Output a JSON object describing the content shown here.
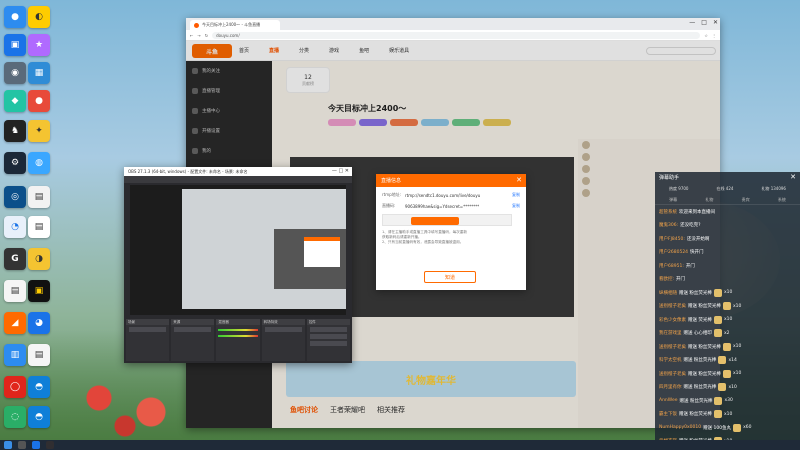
{
  "desktop": {
    "icons": [
      "",
      "",
      "",
      "",
      "",
      "",
      "",
      "",
      "",
      "",
      "",
      "",
      "",
      "",
      "",
      "",
      "",
      "",
      "",
      "",
      "",
      "",
      "",
      "",
      "",
      "",
      "",
      ""
    ]
  },
  "browser": {
    "tab_title": "今天目标冲上2400～ - 斗鱼直播",
    "url": "douyu.com/",
    "window_controls": [
      "—",
      "□",
      "✕"
    ]
  },
  "site": {
    "logo": "斗鱼",
    "nav": [
      "首页",
      "直播",
      "分类",
      "游戏",
      "鱼吧",
      "娱乐道具"
    ],
    "active_nav": "直播",
    "sidebar": [
      "我的关注",
      "直播管理",
      "主播中心",
      "开播设置",
      "我的",
      "关注",
      "帮助"
    ]
  },
  "room": {
    "stat_value": "12",
    "stat_label": "贡献榜",
    "title": "今天目标冲上2400～"
  },
  "page_bottom": {
    "banner": "礼物嘉年华",
    "tabs": [
      "鱼吧讨论",
      "王者荣耀吧",
      "相关推荐"
    ],
    "active_tab": "鱼吧讨论"
  },
  "modal": {
    "title": "直播信息",
    "close": "✕",
    "rtmp_label": "rtmp地址:",
    "rtmp_value": "rtmp://sendtc1.douyu.com/live/douyu",
    "copy_label": "复制",
    "key_label": "直播码:",
    "key_value": "9063899hae&sig=Ydsecret=********",
    "key_copy_label": "复制",
    "notes": [
      "1、请在主播助手或直播工具中填写直播码，每次重新",
      "获取新码后请重新开播。",
      "2、只有当前直播码有效，泄露会导致直播被盗用。"
    ],
    "ok_button": "知道"
  },
  "obs": {
    "title": "OBS 27.1.3 (64-bit, windows) - 配置文件: 未命名 - 场景: 未命名",
    "controls": "— □ ✕",
    "docks": [
      "场景",
      "来源",
      "混音器",
      "转场特效",
      "控件"
    ]
  },
  "chat": {
    "title": "弹幕助手",
    "close": "✕",
    "stats": [
      "热度 9700",
      "在线 424",
      "礼物 134096"
    ],
    "tabs": [
      "弹幕",
      "礼物",
      "贵宾",
      "系统"
    ],
    "messages": [
      {
        "user": "超管系统",
        "text": "欢迎来到本直播间",
        "gift": ""
      },
      {
        "user": "魔鬼306:",
        "text": "还没吃完?",
        "gift": ""
      },
      {
        "user": "用户FJ8450:",
        "text": "还没开始啊",
        "gift": ""
      },
      {
        "user": "用户2680524",
        "text": "快开门",
        "gift": ""
      },
      {
        "user": "用户68951:",
        "text": "开门",
        "gift": ""
      },
      {
        "user": "看欧控:",
        "text": "开门",
        "gift": ""
      },
      {
        "user": "纵横相随",
        "text": "赠送 粉丝荧光棒",
        "gift": "x10"
      },
      {
        "user": "送别橙子老矣",
        "text": "赠送 粉丝荧光棒",
        "gift": "x10"
      },
      {
        "user": "彩色少女像素",
        "text": "赠送 荧光棒",
        "gift": "x10"
      },
      {
        "user": "我在游戏里",
        "text": "赠送 心心相印",
        "gift": "x2"
      },
      {
        "user": "送别橙子老矣",
        "text": "赠送 粉丝荧光棒",
        "gift": "x10"
      },
      {
        "user": "科学太空机",
        "text": "赠送 粉丝荧光棒",
        "gift": "x14"
      },
      {
        "user": "送别橙子老矣",
        "text": "赠送 粉丝荧光棒",
        "gift": "x10"
      },
      {
        "user": "四月里有你",
        "text": "赠送 粉丝荧光棒",
        "gift": "x10"
      },
      {
        "user": "AnnWee",
        "text": "赠送 粉丝荧光棒",
        "gift": "x30"
      },
      {
        "user": "霸主下饭",
        "text": "赠送 粉丝荧光棒",
        "gift": "x10"
      },
      {
        "user": "NumHappy0x0010",
        "text": "赠送 100鱼丸",
        "gift": "x60"
      },
      {
        "user": "云想衣裳",
        "text": "赠送 粉丝荧光棒",
        "gift": "x10"
      }
    ]
  }
}
